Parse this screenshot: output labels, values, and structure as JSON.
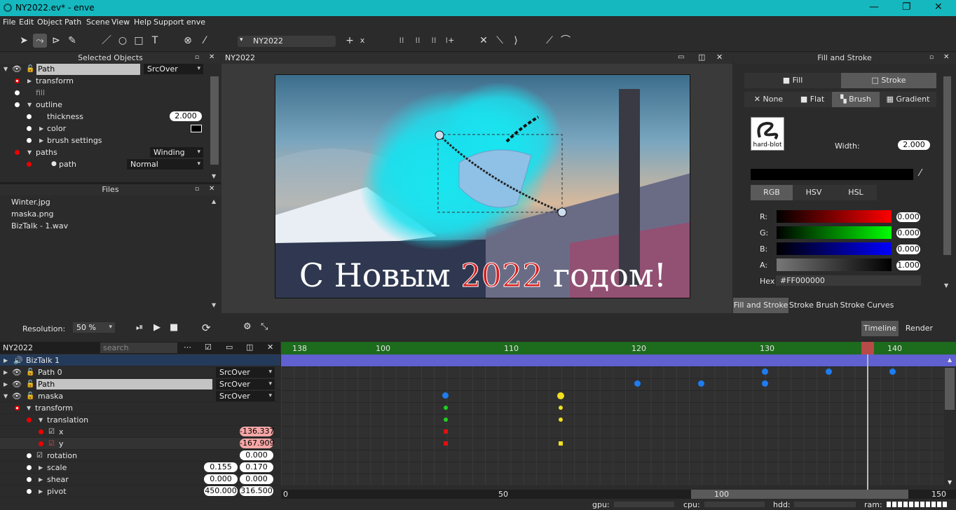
{
  "window": {
    "title": "NY2022.ev* - enve"
  },
  "menu": [
    "File",
    "Edit",
    "Object",
    "Path",
    "Scene",
    "View",
    "Help",
    "Support enve"
  ],
  "toolbar": {
    "scene_name": "NY2022",
    "add": "+",
    "close": "x"
  },
  "selected_objects": {
    "title": "Selected Objects",
    "path_name": "Path",
    "blend": "SrcOver",
    "rows": {
      "transform": "transform",
      "fill": "fill",
      "outline": "outline",
      "thickness": "thickness",
      "thickness_val": "2.000",
      "color": "color",
      "brush_settings": "brush settings",
      "paths": "paths",
      "paths_mode": "Winding",
      "path": "path",
      "path_mode": "Normal"
    }
  },
  "files": {
    "title": "Files",
    "items": [
      "Winter.jpg",
      "maska.png",
      "BizTalk - 1.wav"
    ]
  },
  "canvas": {
    "tab": "NY2022",
    "greeting_a": "С Новым ",
    "greeting_year": "2022",
    "greeting_b": " годом!"
  },
  "fill_stroke": {
    "title": "Fill and Stroke",
    "fill_tab": "Fill",
    "stroke_tab": "Stroke",
    "types": [
      "None",
      "Flat",
      "Brush",
      "Gradient"
    ],
    "brush_name": "hard-blot",
    "width_label": "Width:",
    "width_val": "2.000",
    "models": [
      "RGB",
      "HSV",
      "HSL"
    ],
    "channels": [
      {
        "label": "R:",
        "val": "0.000"
      },
      {
        "label": "G:",
        "val": "0.000"
      },
      {
        "label": "B:",
        "val": "0.000"
      },
      {
        "label": "A:",
        "val": "1.000"
      }
    ],
    "hex_label": "Hex",
    "hex_val": "#FF000000",
    "bottom_tabs": [
      "Fill and Stroke",
      "Stroke Brush",
      "Stroke Curves"
    ]
  },
  "timeline": {
    "resolution_label": "Resolution:",
    "resolution_val": "50 %",
    "tabs": [
      "Timeline",
      "Render"
    ],
    "scene": "NY2022",
    "search_placeholder": "search",
    "ruler": [
      "138",
      "100",
      "110",
      "120",
      "130",
      "140"
    ],
    "bottom_ruler": [
      "0",
      "50",
      "100",
      "150"
    ],
    "rows": {
      "biztalk": "BizTalk  1",
      "path0": "Path 0",
      "path": "Path",
      "maska": "maska",
      "transform": "transform",
      "translation": "translation",
      "x": "x",
      "x_val": "-136.337",
      "y": "y",
      "y_val": "-167.909",
      "rotation": "rotation",
      "rotation_val": "0.000",
      "scale": "scale",
      "scale_x": "0.155",
      "scale_y": "0.170",
      "shear": "shear",
      "shear_x": "0.000",
      "shear_y": "0.000",
      "pivot": "pivot",
      "pivot_x": "450.000",
      "pivot_y": "316.500",
      "blend": "SrcOver"
    }
  },
  "status": {
    "gpu": "gpu:",
    "cpu": "cpu:",
    "hdd": "hdd:",
    "ram": "ram:"
  }
}
